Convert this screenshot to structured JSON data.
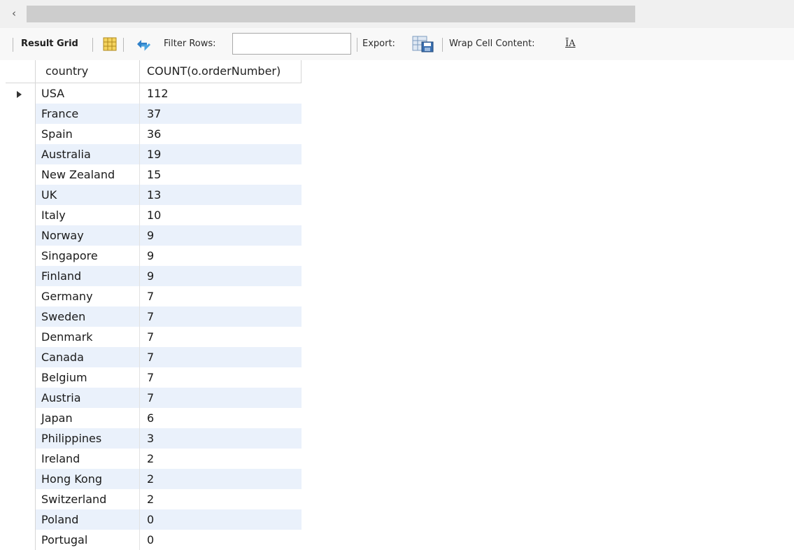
{
  "scrollbar": {
    "left_arrow": "‹"
  },
  "toolbar": {
    "result_grid_label": "Result Grid",
    "filter_rows_label": "Filter Rows:",
    "filter_rows_value": "",
    "export_label": "Export:",
    "wrap_cell_label": "Wrap Cell Content:",
    "wrap_icon_glyph": "ĪA"
  },
  "grid": {
    "columns": [
      "country",
      "COUNT(o.orderNumber)"
    ],
    "rows": [
      [
        "USA",
        "112"
      ],
      [
        "France",
        "37"
      ],
      [
        "Spain",
        "36"
      ],
      [
        "Australia",
        "19"
      ],
      [
        "New Zealand",
        "15"
      ],
      [
        "UK",
        "13"
      ],
      [
        "Italy",
        "10"
      ],
      [
        "Norway",
        "9"
      ],
      [
        "Singapore",
        "9"
      ],
      [
        "Finland",
        "9"
      ],
      [
        "Germany",
        "7"
      ],
      [
        "Sweden",
        "7"
      ],
      [
        "Denmark",
        "7"
      ],
      [
        "Canada",
        "7"
      ],
      [
        "Belgium",
        "7"
      ],
      [
        "Austria",
        "7"
      ],
      [
        "Japan",
        "6"
      ],
      [
        "Philippines",
        "3"
      ],
      [
        "Ireland",
        "2"
      ],
      [
        "Hong Kong",
        "2"
      ],
      [
        "Switzerland",
        "2"
      ],
      [
        "Poland",
        "0"
      ],
      [
        "Portugal",
        "0"
      ]
    ]
  },
  "colors": {
    "row_alt": "#eaf1fb",
    "toolbar_bg": "#f8f8f8",
    "scroll_thumb": "#cdcdcd"
  },
  "icons": [
    "scroll-left-icon",
    "grid-layout-icon",
    "refresh-icon",
    "export-icon",
    "wrap-text-icon",
    "current-row-icon"
  ]
}
